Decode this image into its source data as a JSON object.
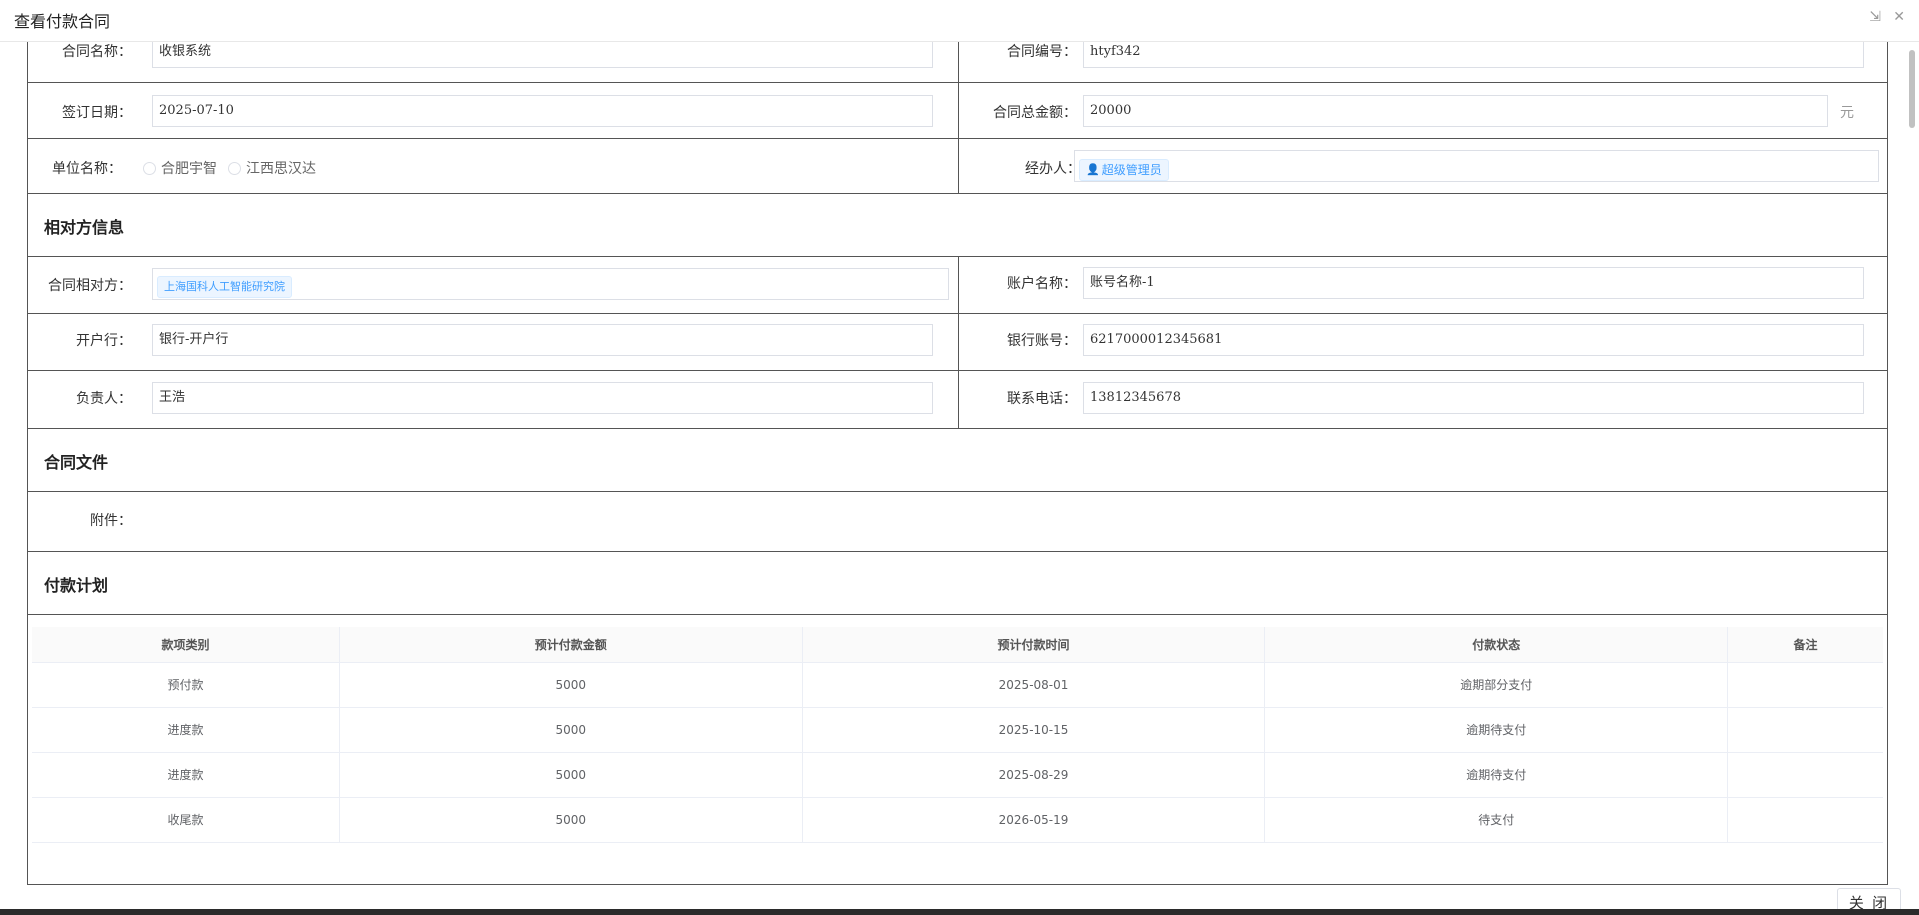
{
  "dialog": {
    "title": "查看付款合同",
    "close_label": "关 闭"
  },
  "basic": {
    "contract_name_label": "合同名称：",
    "contract_name": "收银系统",
    "contract_no_label": "合同编号：",
    "contract_no": "htyf342",
    "sign_date_label": "签订日期：",
    "sign_date": "2025-07-10",
    "total_amount_label": "合同总金额：",
    "total_amount": "20000",
    "amount_unit": "元",
    "unit_label": "单位名称：",
    "unit_options": [
      "合肥宇智",
      "江西思汉达"
    ],
    "handler_label": "经办人：",
    "handler": "超级管理员"
  },
  "counterparty": {
    "section_title": "相对方信息",
    "party_label": "合同相对方：",
    "party": "上海国科人工智能研究院",
    "account_name_label": "账户名称：",
    "account_name": "账号名称-1",
    "bank_label": "开户行：",
    "bank": "银行-开户行",
    "account_no_label": "银行账号：",
    "account_no": "6217000012345681",
    "manager_label": "负责人：",
    "manager": "王浩",
    "phone_label": "联系电话：",
    "phone": "13812345678"
  },
  "files": {
    "section_title": "合同文件",
    "attachment_label": "附件："
  },
  "plan": {
    "section_title": "付款计划",
    "columns": [
      "款项类别",
      "预计付款金额",
      "预计付款时间",
      "付款状态",
      "备注"
    ],
    "rows": [
      [
        "预付款",
        "5000",
        "2025-08-01",
        "逾期部分支付",
        ""
      ],
      [
        "进度款",
        "5000",
        "2025-10-15",
        "逾期待支付",
        ""
      ],
      [
        "进度款",
        "5000",
        "2025-08-29",
        "逾期待支付",
        ""
      ],
      [
        "收尾款",
        "5000",
        "2026-05-19",
        "待支付",
        ""
      ]
    ]
  }
}
